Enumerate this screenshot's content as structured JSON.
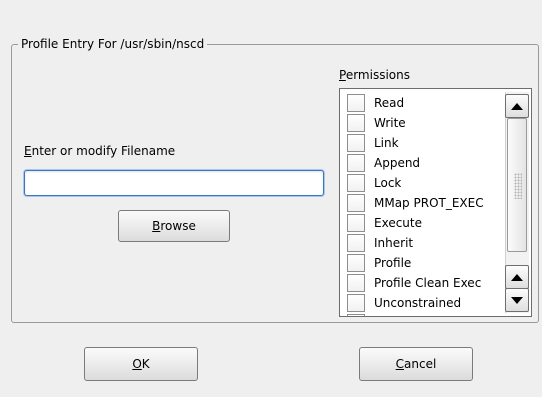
{
  "group": {
    "title": "Profile Entry For /usr/sbin/nscd"
  },
  "filename": {
    "label_mnemonic": "E",
    "label_rest": "nter or modify Filename",
    "value": "",
    "placeholder": ""
  },
  "browse_button": {
    "mnemonic": "B",
    "rest": "rowse"
  },
  "permissions": {
    "label_mnemonic": "P",
    "label_rest": "ermissions",
    "items": [
      {
        "label": "Read",
        "checked": false
      },
      {
        "label": "Write",
        "checked": false
      },
      {
        "label": "Link",
        "checked": false
      },
      {
        "label": "Append",
        "checked": false
      },
      {
        "label": "Lock",
        "checked": false
      },
      {
        "label": "MMap PROT_EXEC",
        "checked": false
      },
      {
        "label": "Execute",
        "checked": false
      },
      {
        "label": "Inherit",
        "checked": false
      },
      {
        "label": "Profile",
        "checked": false
      },
      {
        "label": "Profile Clean Exec",
        "checked": false
      },
      {
        "label": "Unconstrained",
        "checked": false
      }
    ]
  },
  "ok_button": {
    "mnemonic": "O",
    "rest": "K"
  },
  "cancel_button": {
    "mnemonic": "C",
    "rest": "ancel"
  },
  "colors": {
    "focus_border": "#3b76c5",
    "background": "#efefef"
  }
}
